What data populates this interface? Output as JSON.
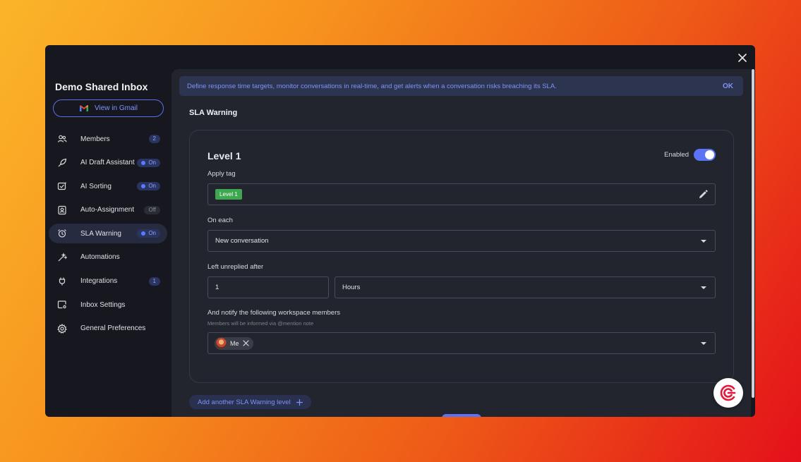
{
  "sidebar": {
    "inbox_title": "Demo Shared Inbox",
    "gmail_button": "View in Gmail",
    "items": [
      {
        "label": "Members",
        "icon": "people-icon",
        "badge": "2",
        "badge_type": "count"
      },
      {
        "label": "AI Draft Assistant",
        "icon": "leaf-pen-icon",
        "badge": "On",
        "badge_type": "on"
      },
      {
        "label": "AI Sorting",
        "icon": "inbox-sparkle-icon",
        "badge": "On",
        "badge_type": "on"
      },
      {
        "label": "Auto-Assignment",
        "icon": "user-badge-icon",
        "badge": "Off",
        "badge_type": "off"
      },
      {
        "label": "SLA Warning",
        "icon": "alarm-clock-icon",
        "badge": "On",
        "badge_type": "on",
        "active": true
      },
      {
        "label": "Automations",
        "icon": "magic-wand-icon"
      },
      {
        "label": "Integrations",
        "icon": "plug-icon",
        "badge": "1",
        "badge_type": "count"
      },
      {
        "label": "Inbox Settings",
        "icon": "inbox-gear-icon"
      },
      {
        "label": "General Preferences",
        "icon": "gear-icon"
      }
    ]
  },
  "banner": {
    "text": "Define response time targets, monitor conversations in real-time, and get alerts when a conversation risks breaching its SLA.",
    "ok": "OK"
  },
  "section_title": "SLA Warning",
  "level": {
    "title": "Level 1",
    "enabled_label": "Enabled",
    "enabled": true,
    "apply_tag_label": "Apply tag",
    "tag_value": "Level 1",
    "on_each_label": "On each",
    "on_each_value": "New conversation",
    "unreplied_label": "Left unreplied after",
    "unreplied_amount": "1",
    "unreplied_unit": "Hours",
    "notify_label": "And notify the following workspace members",
    "notify_sub": "Members will be informed via @mention note",
    "members": [
      "Me"
    ]
  },
  "add_level_button": "Add another SLA Warning level",
  "colors": {
    "accent": "#5b74f5",
    "tag_green": "#3ea851",
    "background_modal": "#17181f",
    "background_content": "#23252e"
  }
}
